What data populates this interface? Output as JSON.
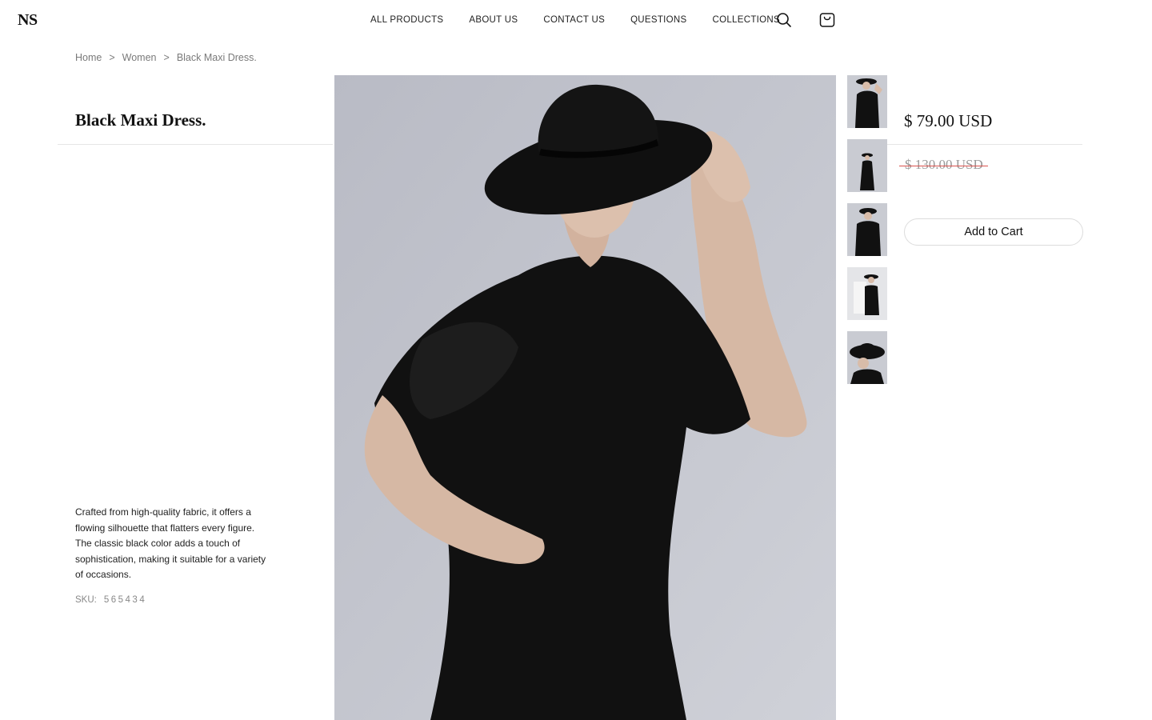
{
  "brand": {
    "logo_text": "NS"
  },
  "nav": {
    "items": [
      {
        "label": "ALL PRODUCTS"
      },
      {
        "label": "ABOUT US"
      },
      {
        "label": "CONTACT US"
      },
      {
        "label": "QUESTIONS"
      },
      {
        "label": "COLLECTIONS"
      }
    ],
    "icons": [
      "search-icon",
      "shopping-bag-icon"
    ]
  },
  "breadcrumb": {
    "items": [
      "Home",
      "Women",
      "Black Maxi Dress."
    ],
    "separator": ">"
  },
  "product": {
    "title": "Black Maxi Dress.",
    "description": "Crafted from high-quality fabric, it offers a flowing silhouette that flatters every figure. The classic black color adds a touch of sophistication, making it suitable for a variety of occasions.",
    "sku_label": "SKU:",
    "sku_value": "565434",
    "price": "$ 79.00 USD",
    "old_price": "$ 130.00 USD",
    "add_to_cart_label": "Add to Cart",
    "thumbnail_count": 5
  },
  "colors": {
    "photo_background": "#c5c7cf",
    "garment": "#111111",
    "sale_strike": "#d9534f",
    "divider": "#e6e6e6"
  }
}
